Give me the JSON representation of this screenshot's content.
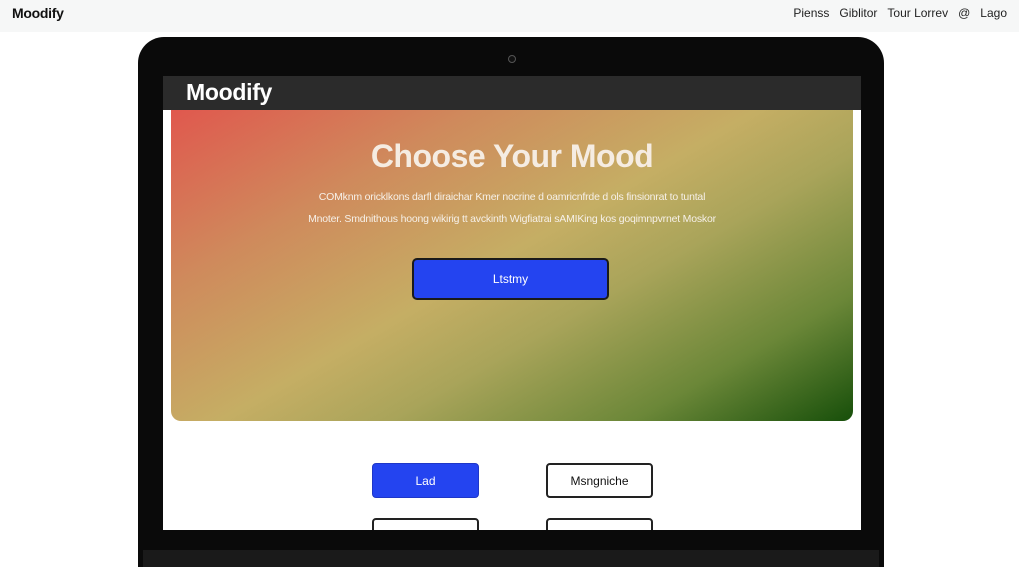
{
  "site": {
    "logo": "Moodify",
    "nav": {
      "item1": "Pienss",
      "item2": "Giblitor",
      "item3": "Tour Lorrev",
      "icon": "at-icon",
      "item4": "Lago"
    }
  },
  "app": {
    "title": "Moodify",
    "hero": {
      "title": "Choose Your Mood",
      "line1": "COMknm oricklkons darfl diraichar Kmer nocrine d oamricnfrde d ols finsionrat to tuntal",
      "line2": "Mnoter. Smdnithous hoong wikirig tt avckinth Wigfiatrai sAMIKing kos goqimnpvrnet Moskor",
      "button": "Ltstmy"
    },
    "options": {
      "primary": "Lad",
      "secondary": "Msngniche",
      "third": "",
      "fourth": ""
    }
  },
  "colors": {
    "accent": "#2444f0",
    "header": "#2b2b2b",
    "gradient_start": "#e0584e",
    "gradient_end": "#174f0a"
  }
}
